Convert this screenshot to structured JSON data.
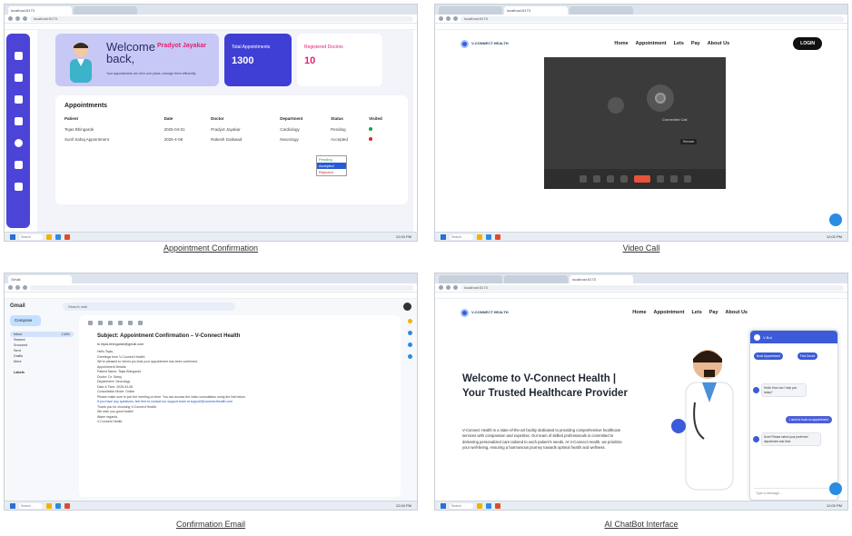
{
  "browser": {
    "tab_label": "localhost:5173",
    "url": "localhost:5173",
    "taskbar_search": "Search",
    "clock": "12:00 PM"
  },
  "panels": [
    {
      "caption": "Appointment Confirmation",
      "sidebar_icons": [
        "home-icon",
        "doctor-icon",
        "heart-icon",
        "user-icon",
        "chat-icon",
        "video-icon",
        "logout-icon"
      ],
      "welcome": {
        "title": "Welcome back,",
        "name": "Pradyot Jayakar",
        "subtitle": "Your appointments are all in one place, manage them efficiently."
      },
      "stats": [
        {
          "label": "Total Appointments",
          "value": "1300"
        },
        {
          "label": "Registered Doctors",
          "value": "10"
        }
      ],
      "appointments": {
        "title": "Appointments",
        "columns": [
          "Patient",
          "Date",
          "Doctor",
          "Department",
          "Status",
          "Visited"
        ],
        "rows": [
          [
            "Tejas Bhingarde",
            "2025-04-01",
            "Pradyot Jayakar",
            "Cardiology",
            "Pending",
            "yes"
          ],
          [
            "Sunil Sahaj Appointment",
            "2025-4-08",
            "Rakesh Gaikwad",
            "Neurology",
            "Accepted",
            "no"
          ]
        ],
        "dropdown": [
          "Pending",
          "Accepted",
          "Rejected"
        ]
      }
    },
    {
      "caption": "Video Call",
      "nav": [
        "Home",
        "Appointment",
        "Lets",
        "Pay",
        "About Us"
      ],
      "logo": "V-CONNECT HEALTH",
      "login": "LOGIN",
      "video": {
        "label": "Connected Call",
        "pill": "Remote"
      }
    },
    {
      "caption": "Confirmation Email",
      "gmail": {
        "logo": "Gmail",
        "search": "Search mail",
        "compose": "Compose",
        "folders": [
          {
            "label": "Inbox",
            "count": "2,831"
          },
          {
            "label": "Starred",
            "count": ""
          },
          {
            "label": "Snoozed",
            "count": ""
          },
          {
            "label": "Sent",
            "count": ""
          },
          {
            "label": "Drafts",
            "count": ""
          },
          {
            "label": "More",
            "count": ""
          },
          {
            "label": "Labels",
            "count": ""
          }
        ],
        "subject": "Subject: Appointment Confirmation – V-Connect Health",
        "sender": "to tejas.bhingarde@gmail.com",
        "body": [
          "Hello Tejas,",
          "Greetings from V-Connect Health!",
          "We're pleased to inform you that your appointment has been confirmed.",
          "Appointment Details:",
          "Patient Name: Tejas Bhingarde",
          "Doctor: Dr. Sahaj",
          "Department: Neurology",
          "Date & Time: 2025-04-08",
          "Consultation Mode: Online",
          "Please make sure to join the meeting on time. You can access the video consultation using the link below.",
          "If you have any questions, feel free to contact our support team at support@vconnecthealth.com",
          "Thank you for choosing V-Connect Health.",
          "We wish you good health!",
          "Warm regards,",
          "V-Connect Health"
        ]
      }
    },
    {
      "caption": "AI ChatBot Interface",
      "nav": [
        "Home",
        "Appointment",
        "Lets",
        "Pay",
        "About Us"
      ],
      "logo": "V-CONNECT HEALTH",
      "hero_title": "Welcome to V-Connect Health | Your Trusted Healthcare Provider",
      "hero_text": "V-Connect Health is a state-of-the-art facility dedicated to providing comprehensive healthcare services with compassion and expertise. Our team of skilled professionals is committed to delivering personalized care tailored to each patient's needs. At V-Connect Health, we prioritize your well-being, ensuring a harmonious journey towards optimal health and wellness.",
      "chat": {
        "title": "V-Bot",
        "options": [
          "Book Appointment",
          "Find Doctor"
        ],
        "bot_msg_1": "Hello! How can I help you today?",
        "user_msg": "I need to book an appointment",
        "bot_msg_2": "Sure! Please select your preferred department and time.",
        "input_placeholder": "Type a message..."
      }
    }
  ],
  "colors": {
    "sidebar": "#4b44d6",
    "accent_pink": "#e0226e",
    "brand_blue": "#3b5bd9",
    "end_call": "#e5533b"
  }
}
